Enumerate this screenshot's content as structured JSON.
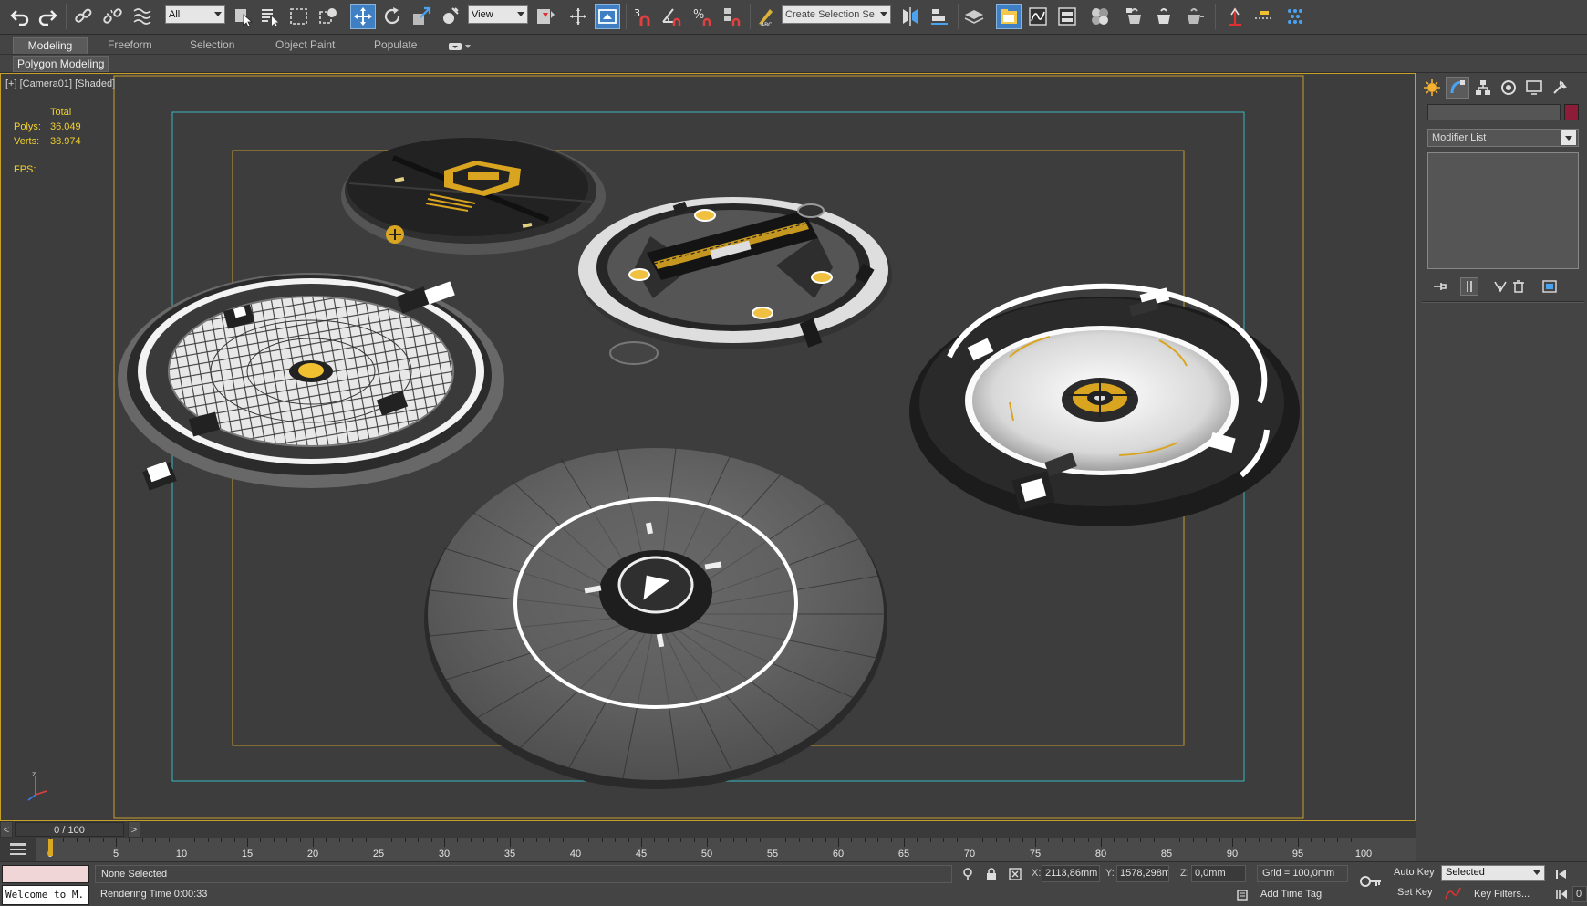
{
  "toolbar": {
    "selection_filter": "All",
    "ref_coord_system": "View",
    "named_selection_placeholder": "Create Selection Se",
    "snap_label": "3"
  },
  "ribbon": {
    "tabs": [
      {
        "label": "Modeling",
        "active": true
      },
      {
        "label": "Freeform",
        "active": false
      },
      {
        "label": "Selection",
        "active": false
      },
      {
        "label": "Object Paint",
        "active": false
      },
      {
        "label": "Populate",
        "active": false
      }
    ],
    "panel_label": "Polygon Modeling"
  },
  "viewport": {
    "label": "[+] [Camera01] [Shaded]",
    "stats": {
      "header": "Total",
      "polys_label": "Polys:",
      "polys_value": "36.049",
      "verts_label": "Verts:",
      "verts_value": "38.974",
      "fps_label": "FPS:"
    }
  },
  "command_panel": {
    "modifier_list_label": "Modifier List",
    "object_color": "#8d1c38"
  },
  "time_slider": {
    "position_label": "0 / 100",
    "prev_label": "<",
    "next_label": ">"
  },
  "trackbar": {
    "ticks": [
      0,
      5,
      10,
      15,
      20,
      25,
      30,
      35,
      40,
      45,
      50,
      55,
      60,
      65,
      70,
      75,
      80,
      85,
      90,
      95,
      100
    ]
  },
  "status": {
    "maxscript_text": "Welcome to M.",
    "selection_message": "None Selected",
    "prompt_message": "Rendering Time  0:00:33",
    "x_label": "X:",
    "x_value": "2113,86mm",
    "y_label": "Y:",
    "y_value": "1578,298m",
    "z_label": "Z:",
    "z_value": "0,0mm",
    "grid_label": "Grid = 100,0mm",
    "add_time_tag": "Add Time Tag",
    "auto_key": "Auto Key",
    "set_key": "Set Key",
    "key_mode": "Selected",
    "key_filters": "Key Filters...",
    "frame_field": "0"
  },
  "colors": {
    "accent_blue": "#3f7fc4",
    "safe_frame_yellow": "#c7a02a",
    "safe_frame_cyan": "#36b6c0",
    "stat_yellow": "#f0d030"
  }
}
